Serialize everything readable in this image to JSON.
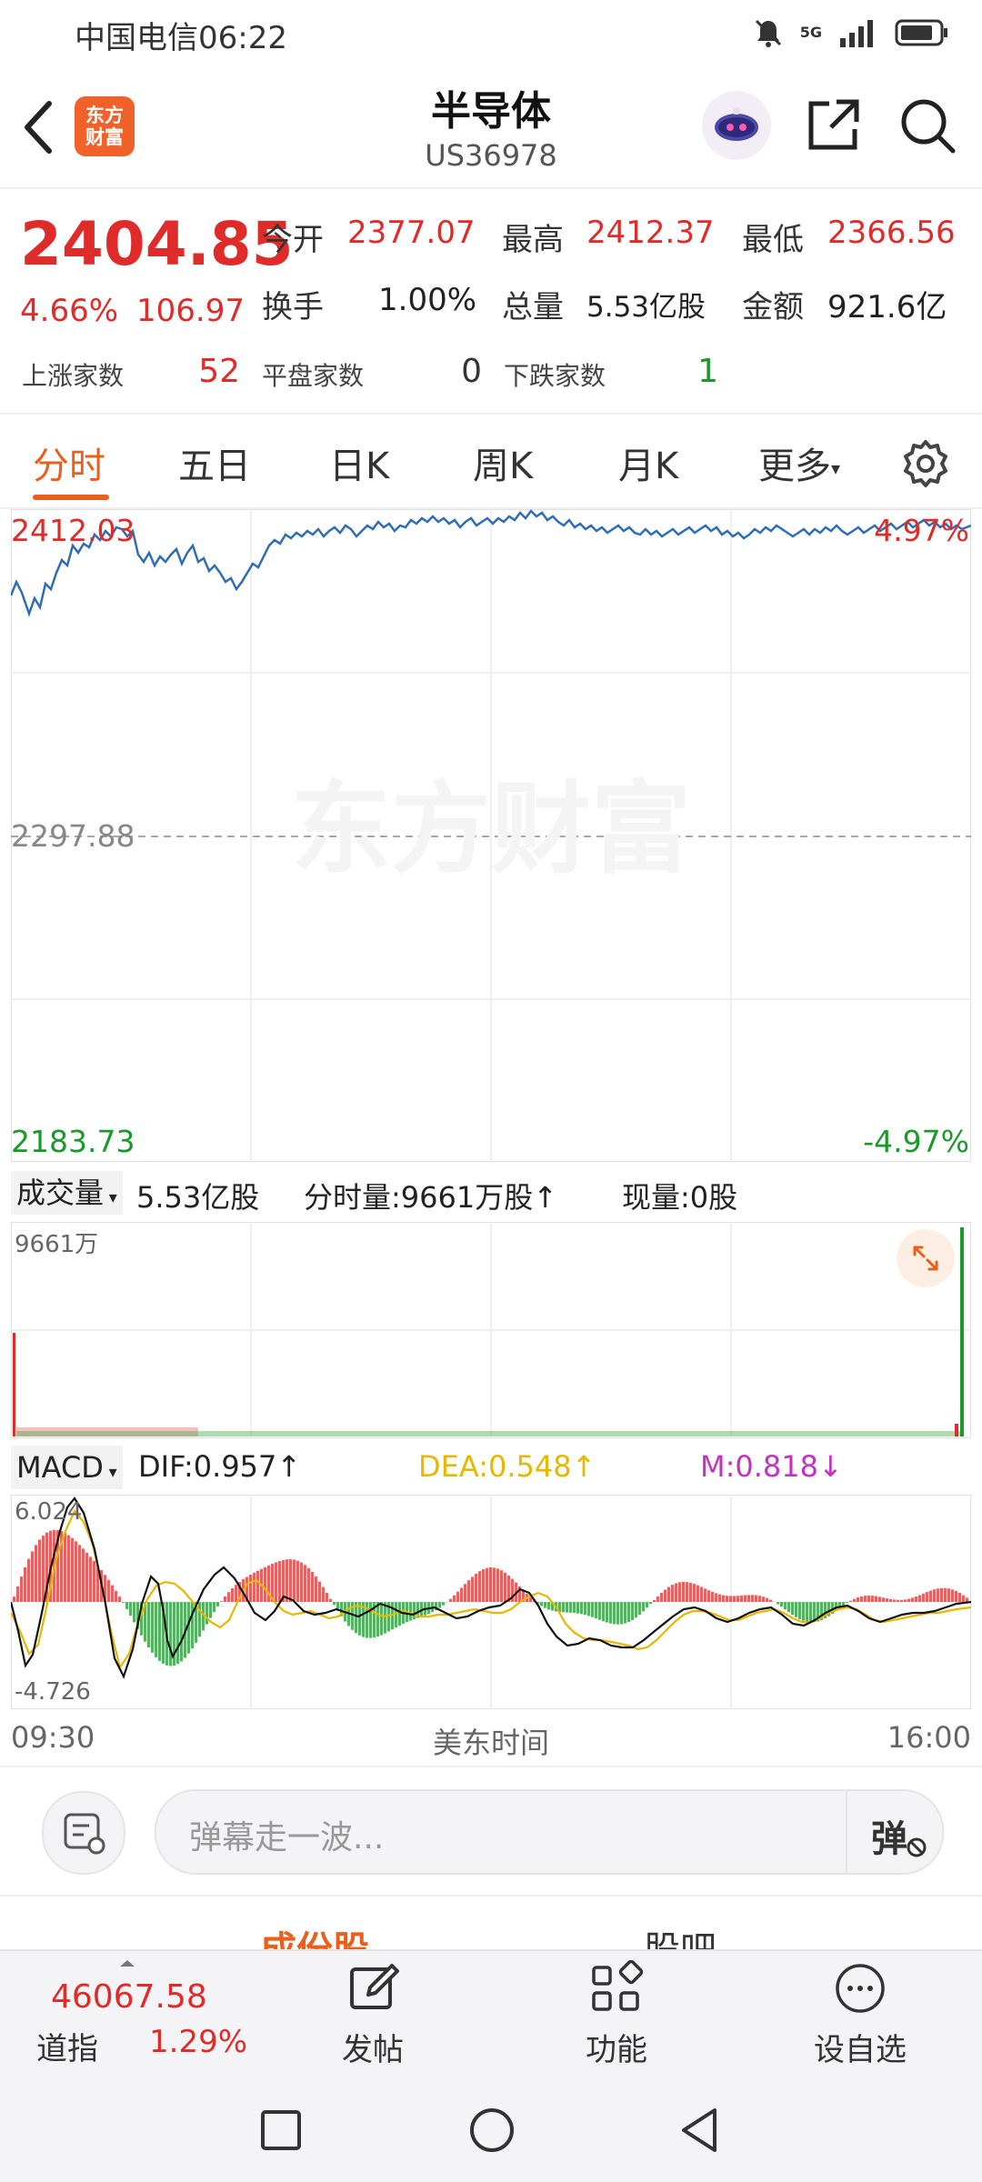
{
  "status_bar": {
    "carrier": "中国电信",
    "time": "06:22",
    "network": "5G"
  },
  "header": {
    "title": "半导体",
    "code": "US36978",
    "logo_top": "东方",
    "logo_bottom": "财富"
  },
  "quote": {
    "price": "2404.85",
    "change_pct": "4.66%",
    "change": "106.97",
    "open_label": "今开",
    "open": "2377.07",
    "high_label": "最高",
    "high": "2412.37",
    "low_label": "最低",
    "low": "2366.56",
    "turnover_label": "换手",
    "turnover": "1.00%",
    "volume_label": "总量",
    "volume": "5.53亿股",
    "amount_label": "金额",
    "amount": "921.6亿",
    "up_label": "上涨家数",
    "up": "52",
    "flat_label": "平盘家数",
    "flat": "0",
    "down_label": "下跌家数",
    "down": "1"
  },
  "tabs": [
    {
      "label": "分时",
      "active": true
    },
    {
      "label": "五日"
    },
    {
      "label": "日K"
    },
    {
      "label": "周K"
    },
    {
      "label": "月K"
    },
    {
      "label": "更多"
    }
  ],
  "intraday": {
    "high_label": "2412.03",
    "mid_label": "2297.88",
    "low_label": "2183.73",
    "high_pct": "4.97%",
    "low_pct": "-4.97%",
    "watermark": "东方财富"
  },
  "volume_bar": {
    "selector": "成交量",
    "total": "5.53亿股",
    "period_label": "分时量:9661万股↑",
    "current_label": "现量:0股",
    "max_label": "9661万"
  },
  "macd": {
    "selector": "MACD",
    "dif": "DIF:0.957↑",
    "dea": "DEA:0.548↑",
    "m": "M:0.818↓",
    "max_label": "6.024",
    "min_label": "-4.726"
  },
  "time_axis": {
    "start": "09:30",
    "middle": "美东时间",
    "end": "16:00"
  },
  "danmaku": {
    "placeholder": "弹幕走一波...",
    "button": "弹"
  },
  "sub_tabs": {
    "left": "成份股",
    "right": "股吧"
  },
  "bottom_bar": {
    "index_value": "46067.58",
    "index_name": "道指",
    "index_pct": "1.29%",
    "post_label": "发帖",
    "function_label": "功能",
    "watchlist_label": "设自选"
  },
  "colors": {
    "up": "#e02b2b",
    "down": "#1a9a2b",
    "line": "#2f6db5",
    "accent": "#e8601c",
    "dea": "#e6b800",
    "m": "#c233c2"
  }
}
